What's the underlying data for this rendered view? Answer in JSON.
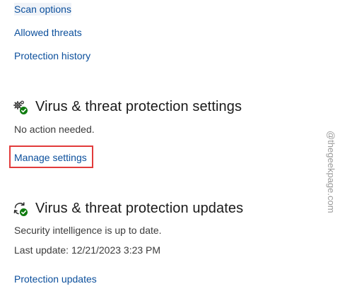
{
  "top_links": {
    "scan_options": "Scan options",
    "allowed_threats": "Allowed threats",
    "protection_history": "Protection history"
  },
  "settings_section": {
    "icon": "gear-shield-check-icon",
    "title": "Virus & threat protection settings",
    "status": "No action needed.",
    "manage_link": "Manage settings"
  },
  "updates_section": {
    "icon": "refresh-check-icon",
    "title": "Virus & threat protection updates",
    "status": "Security intelligence is up to date.",
    "last_update": "Last update: 12/21/2023 3:23 PM",
    "updates_link": "Protection updates"
  },
  "watermark": "@thegeekpage.com",
  "colors": {
    "link": "#0b4f9c",
    "highlight_border": "#e23b3b",
    "status_ok": "#107c10"
  }
}
